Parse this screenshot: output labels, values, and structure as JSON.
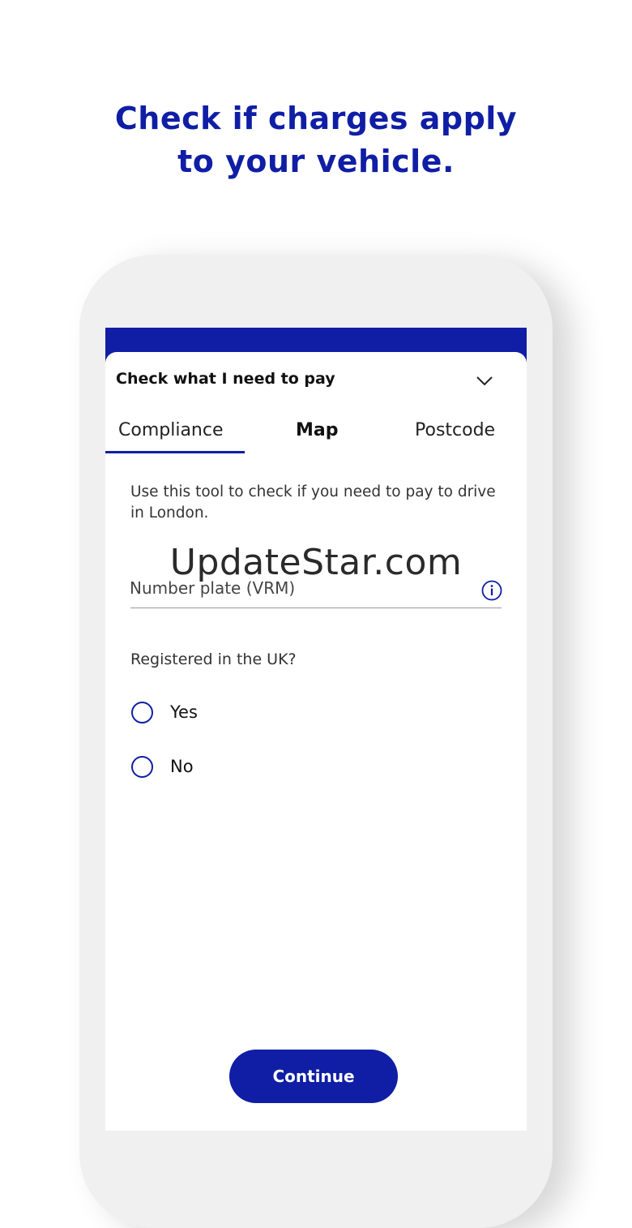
{
  "headline": {
    "line1": "Check if charges apply",
    "line2": "to your vehicle."
  },
  "accordion": {
    "title": "Check what I need to pay",
    "icon": "chevron-down-icon"
  },
  "tabs": [
    {
      "label": "Compliance",
      "selected": true
    },
    {
      "label": "Map",
      "selected": false
    },
    {
      "label": "Postcode",
      "selected": false
    }
  ],
  "form": {
    "intro": "Use this tool to check if you need to pay to drive in London.",
    "vrm_label": "Number plate (VRM)",
    "info_icon": "info-icon",
    "registered_question": "Registered in the UK?",
    "options": [
      {
        "label": "Yes",
        "selected": false
      },
      {
        "label": "No",
        "selected": false
      }
    ],
    "continue_label": "Continue"
  },
  "watermark": "UpdateStar.com",
  "colors": {
    "brand": "#0f1ea5",
    "phone_frame": "#f0f0f1",
    "background": "#ffffff"
  }
}
